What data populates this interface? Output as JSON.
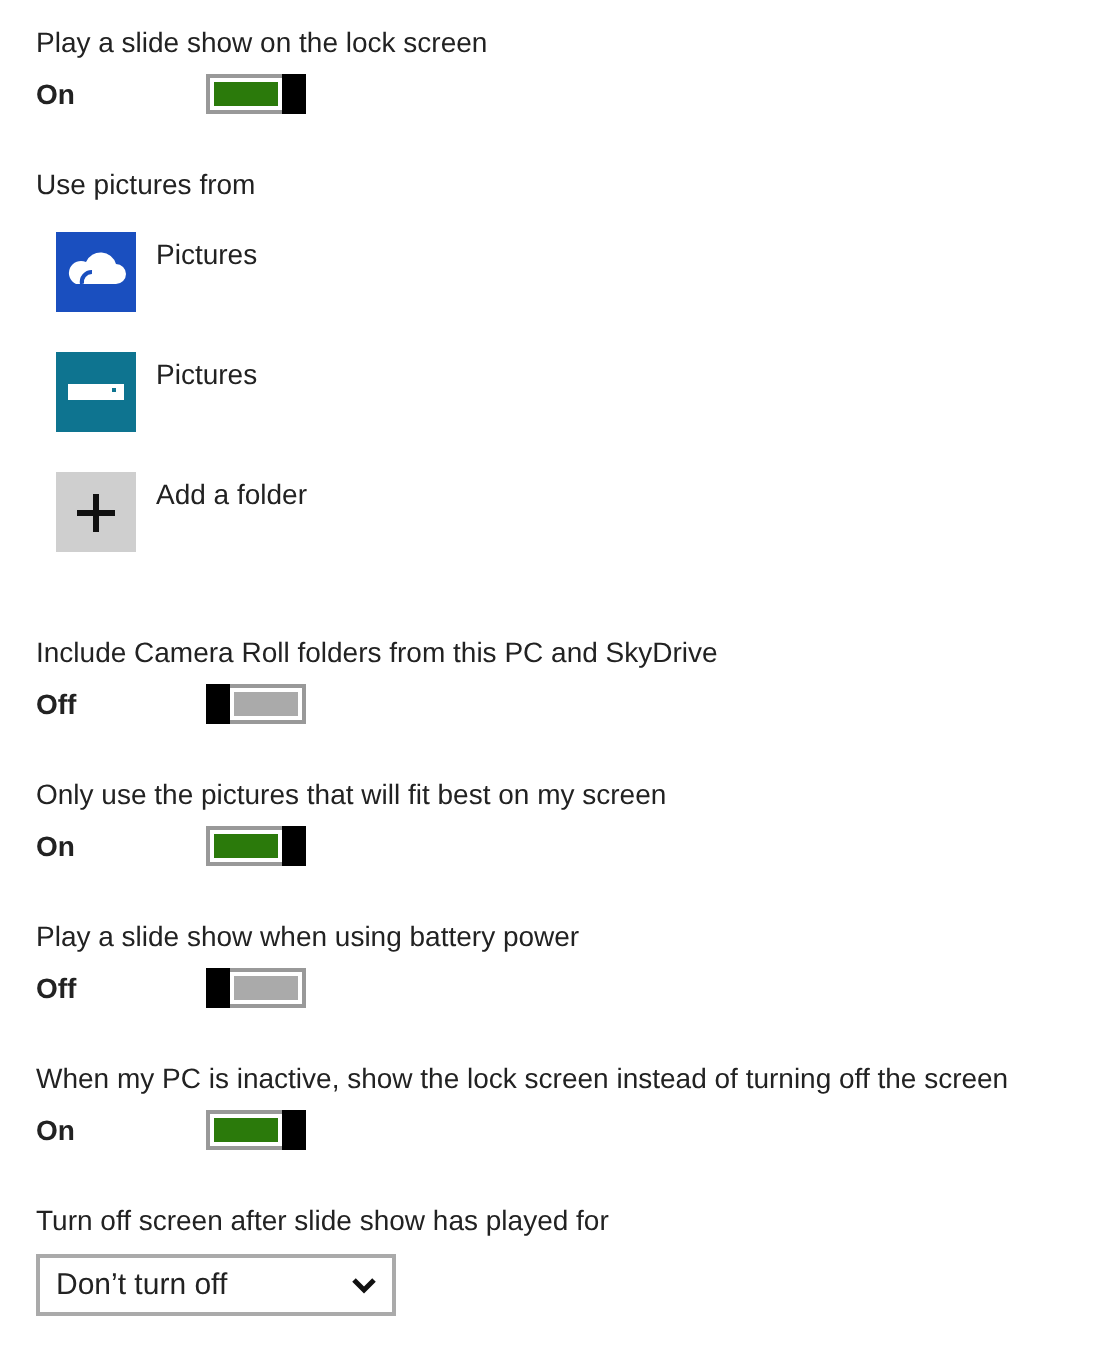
{
  "sections": [
    {
      "kind": "toggle",
      "label": "Play a slide show on the lock screen",
      "state": "On",
      "on": true
    },
    {
      "kind": "folders",
      "label": "Use pictures from",
      "folders": [
        {
          "kind": "cloud",
          "label": "Pictures"
        },
        {
          "kind": "drive",
          "label": "Pictures"
        },
        {
          "kind": "add",
          "label": "Add a folder"
        }
      ]
    },
    {
      "kind": "toggle",
      "label": "Include Camera Roll folders from this PC and SkyDrive",
      "state": "Off",
      "on": false
    },
    {
      "kind": "toggle",
      "label": "Only use the pictures that will fit best on my screen",
      "state": "On",
      "on": true
    },
    {
      "kind": "toggle",
      "label": "Play a slide show when using battery power",
      "state": "Off",
      "on": false
    },
    {
      "kind": "toggle",
      "label": "When my PC is inactive, show the lock screen instead of turning off the screen",
      "state": "On",
      "on": true
    },
    {
      "kind": "dropdown",
      "label": "Turn off screen after slide show has played for",
      "value": "Don’t turn off"
    }
  ]
}
